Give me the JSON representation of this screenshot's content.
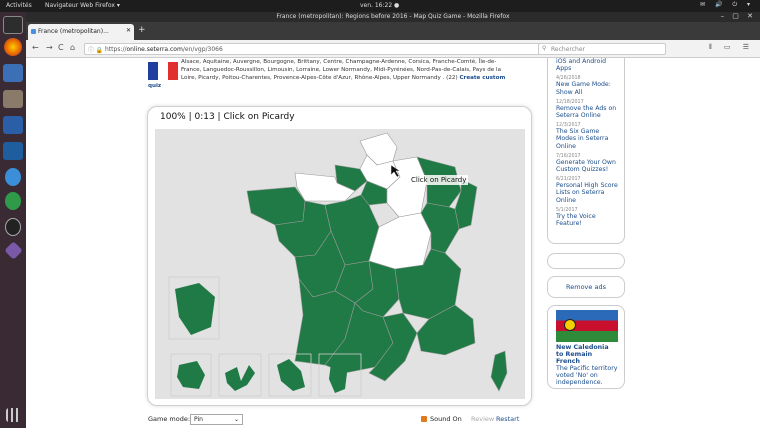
{
  "os": {
    "activities": "Activités",
    "app_menu": "Navigateur Web Firefox ▾",
    "clock": "ven. 16:22 ●",
    "tray": "✉ 🔊 ⏻ ▾"
  },
  "browser": {
    "window_title": "France (metropolitan): Regions before 2016 - Map Quiz Game - Mozilla Firefox",
    "window_controls": "– ▢ ✕",
    "tab_title": "France (metropolitan)...",
    "tab_close": "✕",
    "new_tab": "+",
    "url_prefix": "https://",
    "url_domain": "online.seterra.com",
    "url_path": "/en/vgp/3066",
    "search_placeholder": "Rechercher",
    "icons": {
      "back": "←",
      "forward": "→",
      "reload": "C",
      "home": "⌂",
      "lock": "ⓘ 🔒",
      "tools": "⫴ ▭ ☰"
    }
  },
  "page": {
    "regions_text": "Alsace, Aquitaine, Auvergne, Bourgogne, Brittany, Centre, Champagne-Ardenne, Corsica, Franche-Comté, Île-de-France, Languedoc-Roussillon, Limousin, Lorraine, Lower Normandy, Midi-Pyrénées, Nord-Pas-de-Calais, Pays de la Loire, Picardy, Poitou-Charentes, Provence-Alpes-Côte d'Azur, Rhône-Alpes, Upper Normandy . (22)",
    "create_custom": "Create custom",
    "quiz_label": "quiz",
    "quiz_header": "100% | 0:13 | Click on Picardy",
    "tooltip": "Click on Picardy",
    "game_mode_label": "Game mode:",
    "game_mode_value": "Pin",
    "sound_on": "Sound On",
    "review": "Review",
    "restart": "Restart",
    "colors": {
      "correct": "#1f7a45",
      "unanswered": "#ffffff",
      "sea": "#e2e2e2"
    }
  },
  "sidebar": {
    "news": [
      {
        "date": "",
        "title": "iOS and Android Apps"
      },
      {
        "date": "4/26/2018",
        "title": "New Game Mode: Show All"
      },
      {
        "date": "12/18/2017",
        "title": "Remove the Ads on Seterra Online"
      },
      {
        "date": "12/3/2017",
        "title": "The Six Game Modes in Seterra Online"
      },
      {
        "date": "7/16/2017",
        "title": "Generate Your Own Custom Quizzes!"
      },
      {
        "date": "6/21/2017",
        "title": "Personal High Score Lists on Seterra Online"
      },
      {
        "date": "5/1/2017",
        "title": "Try the Voice Feature!"
      }
    ],
    "remove_ads": "Remove ads",
    "ad_title": "New Caledonia to Remain French",
    "ad_body": "The Pacific territory voted 'No' on independence."
  }
}
